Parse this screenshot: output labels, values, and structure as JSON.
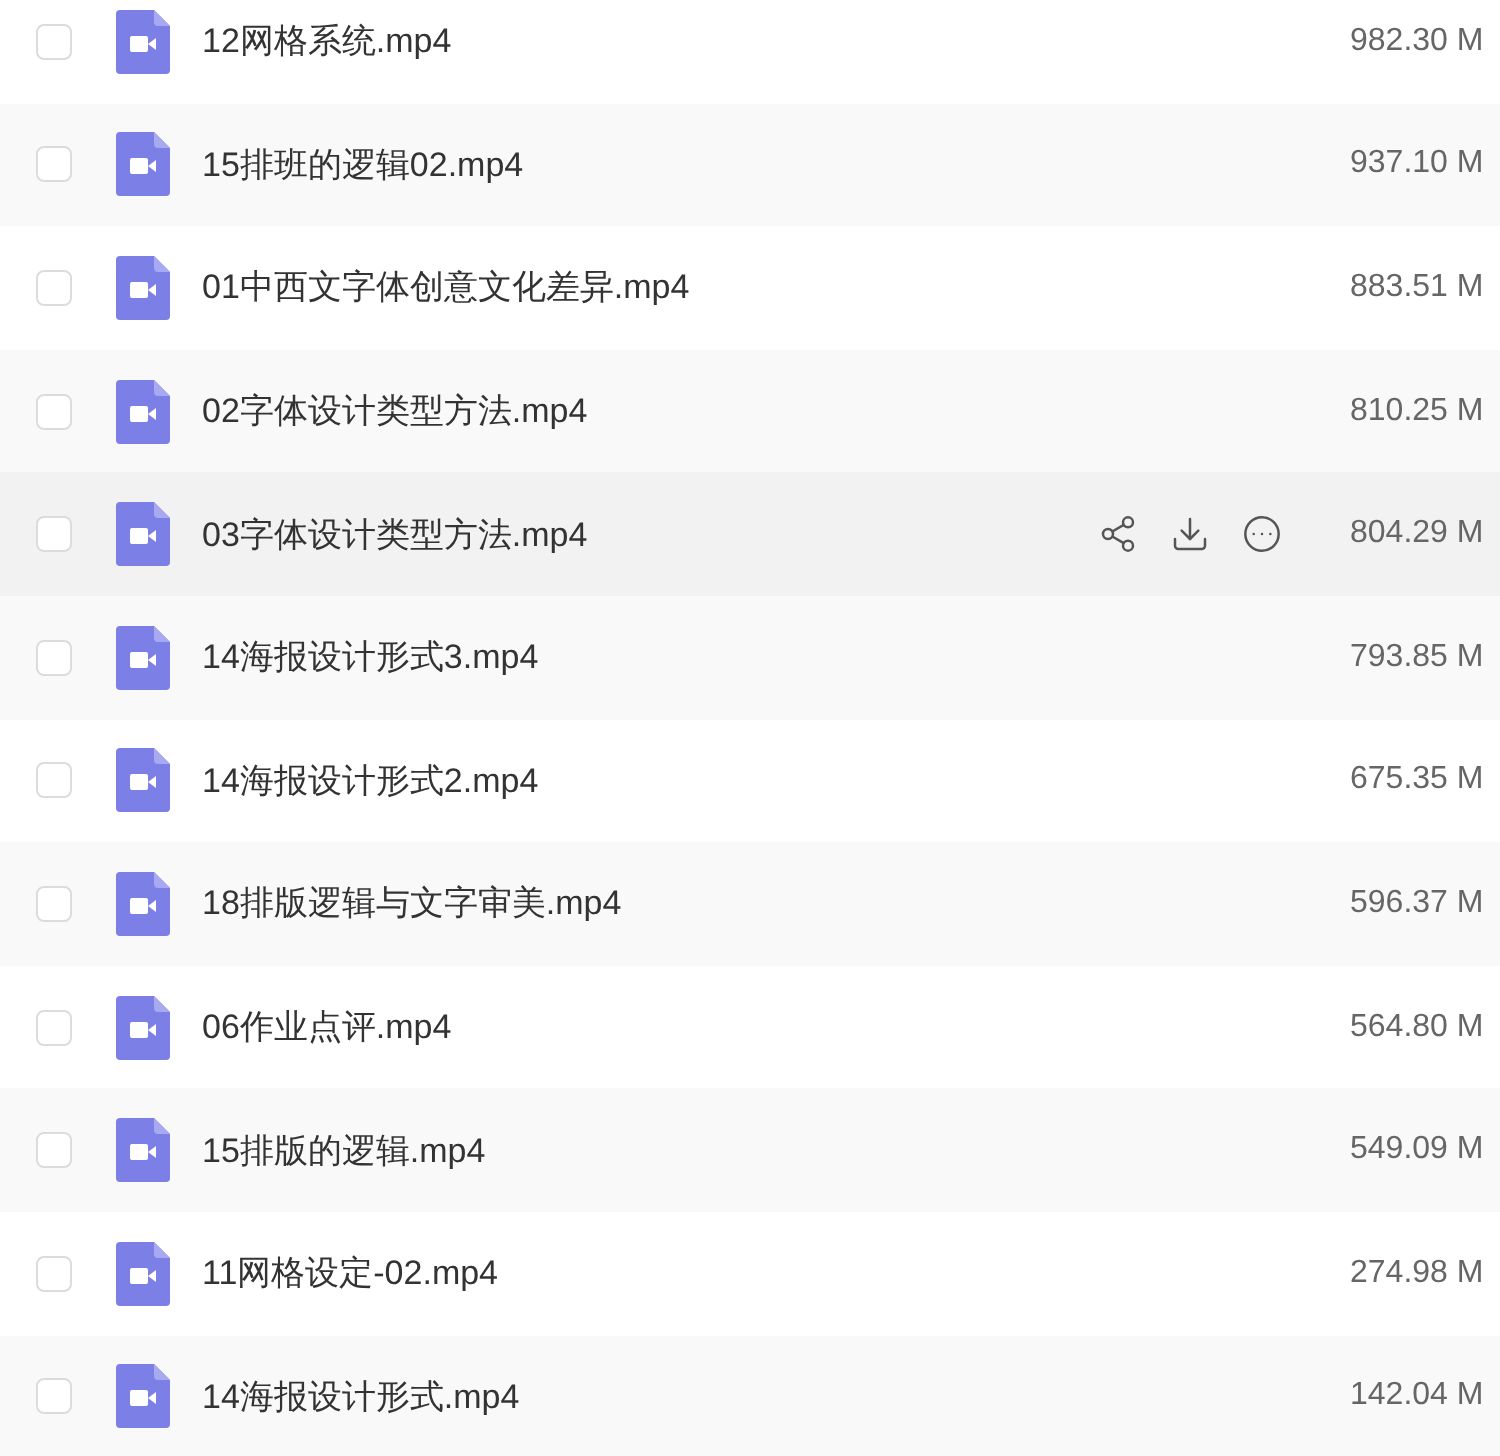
{
  "files": [
    {
      "name": "12网格系统.mp4",
      "size": "982.30 M",
      "checked": false,
      "hovered": false
    },
    {
      "name": "15排班的逻辑02.mp4",
      "size": "937.10 M",
      "checked": false,
      "hovered": false
    },
    {
      "name": "01中西文字体创意文化差异.mp4",
      "size": "883.51 M",
      "checked": false,
      "hovered": false
    },
    {
      "name": "02字体设计类型方法.mp4",
      "size": "810.25 M",
      "checked": false,
      "hovered": false
    },
    {
      "name": "03字体设计类型方法.mp4",
      "size": "804.29 M",
      "checked": false,
      "hovered": true
    },
    {
      "name": "14海报设计形式3.mp4",
      "size": "793.85 M",
      "checked": false,
      "hovered": false
    },
    {
      "name": "14海报设计形式2.mp4",
      "size": "675.35 M",
      "checked": false,
      "hovered": false
    },
    {
      "name": "18排版逻辑与文字审美.mp4",
      "size": "596.37 M",
      "checked": false,
      "hovered": false
    },
    {
      "name": "06作业点评.mp4",
      "size": "564.80 M",
      "checked": false,
      "hovered": false
    },
    {
      "name": "15排版的逻辑.mp4",
      "size": "549.09 M",
      "checked": false,
      "hovered": false
    },
    {
      "name": "11网格设定-02.mp4",
      "size": "274.98 M",
      "checked": false,
      "hovered": false
    },
    {
      "name": "14海报设计形式.mp4",
      "size": "142.04 M",
      "checked": false,
      "hovered": false
    }
  ]
}
